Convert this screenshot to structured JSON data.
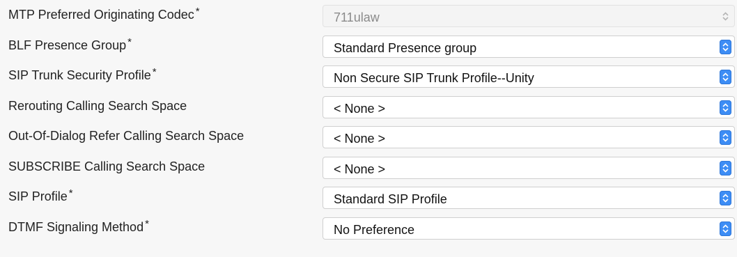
{
  "fields": [
    {
      "label": "MTP Preferred Originating Codec",
      "required": "*",
      "value": "711ulaw",
      "disabled": true
    },
    {
      "label": "BLF Presence Group",
      "required": "*",
      "value": "Standard Presence group",
      "disabled": false
    },
    {
      "label": "SIP Trunk Security Profile",
      "required": "*",
      "value": "Non Secure SIP Trunk Profile--Unity",
      "disabled": false
    },
    {
      "label": "Rerouting Calling Search Space",
      "required": "",
      "value": "< None >",
      "disabled": false
    },
    {
      "label": "Out-Of-Dialog Refer Calling Search Space",
      "required": "",
      "value": "< None >",
      "disabled": false
    },
    {
      "label": "SUBSCRIBE Calling Search Space",
      "required": "",
      "value": "< None >",
      "disabled": false
    },
    {
      "label": "SIP Profile",
      "required": "*",
      "value": "Standard SIP Profile",
      "disabled": false
    },
    {
      "label": "DTMF Signaling Method",
      "required": "*",
      "value": "No Preference",
      "disabled": false
    }
  ],
  "colors": {
    "accent": "#3d8df5",
    "background": "#f7f7f7",
    "disabled_text": "#8a8a8a"
  },
  "icons": {
    "dropdown": "chevron-up-down-icon"
  }
}
